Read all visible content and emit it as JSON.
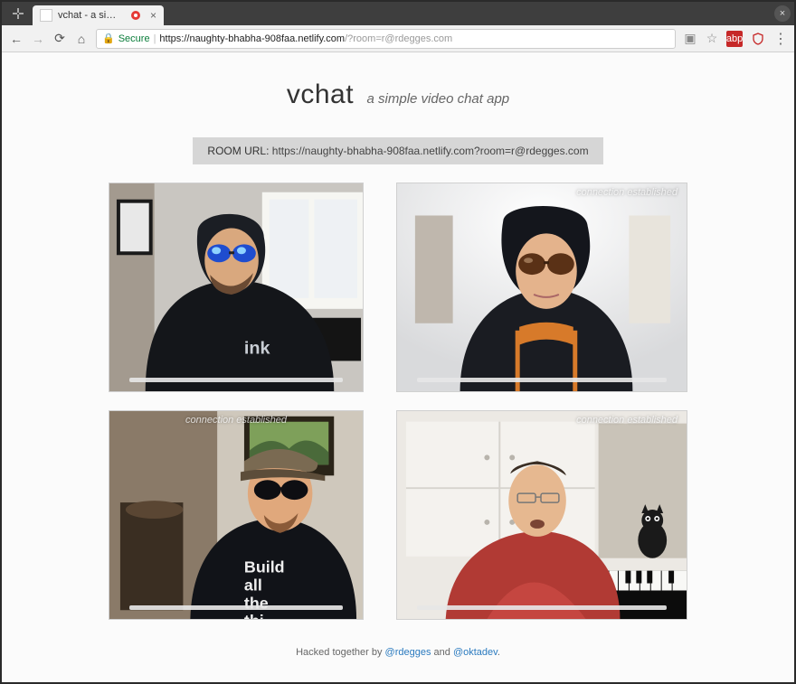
{
  "browser": {
    "tab_title": "vchat - a simple vi…",
    "window_close": "×",
    "tab_close": "×",
    "secure_label": "Secure",
    "url_scheme": "https",
    "url_host": "://naughty-bhabha-908faa.netlify.com",
    "url_path": "/?room=r@rdegges.com",
    "ext_red": "abp",
    "kebab": "⋮"
  },
  "header": {
    "logo": "vchat",
    "tagline": "a simple video chat app"
  },
  "room": {
    "label": "ROOM URL:",
    "url": "https://naughty-bhabha-908faa.netlify.com?room=r@rdegges.com"
  },
  "tiles": {
    "conn_text": "connection established"
  },
  "footer": {
    "prefix": "Hacked together by ",
    "link1": "@rdegges",
    "mid": " and ",
    "link2": "@oktadev",
    "suffix": "."
  }
}
